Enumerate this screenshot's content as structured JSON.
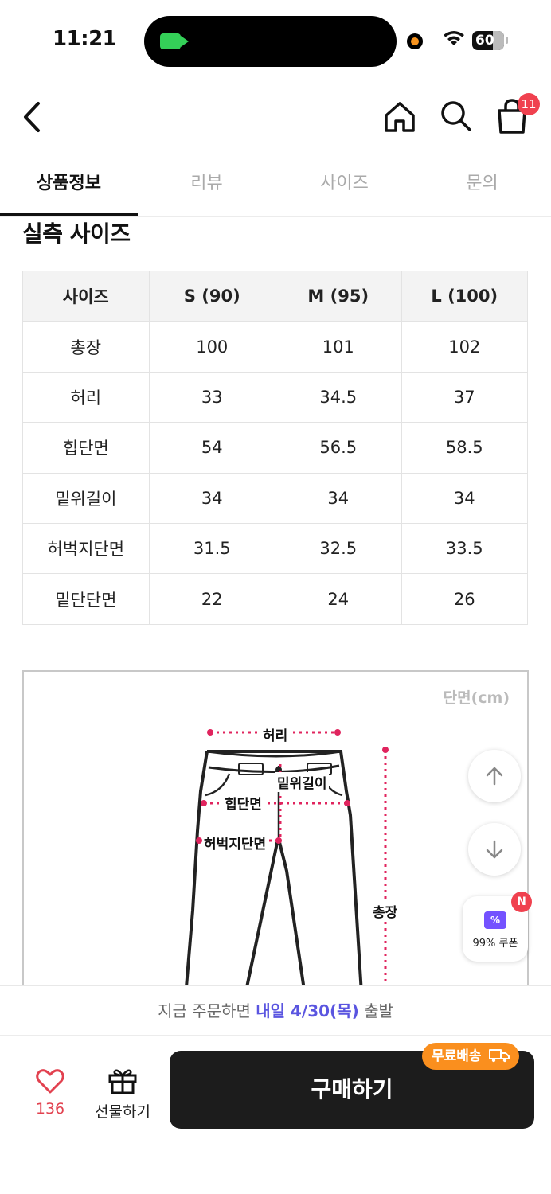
{
  "status": {
    "time": "11:21",
    "battery": "60"
  },
  "header": {
    "cart_count": "11"
  },
  "tabs": [
    {
      "label": "상품정보",
      "active": true
    },
    {
      "label": "리뷰"
    },
    {
      "label": "사이즈"
    },
    {
      "label": "문의"
    }
  ],
  "size_section": {
    "title": "실측 사이즈",
    "headers": [
      "사이즈",
      "S (90)",
      "M (95)",
      "L (100)"
    ],
    "rows": [
      [
        "총장",
        "100",
        "101",
        "102"
      ],
      [
        "허리",
        "33",
        "34.5",
        "37"
      ],
      [
        "힙단면",
        "54",
        "56.5",
        "58.5"
      ],
      [
        "밑위길이",
        "34",
        "34",
        "34"
      ],
      [
        "허벅지단면",
        "31.5",
        "32.5",
        "33.5"
      ],
      [
        "밑단단면",
        "22",
        "24",
        "26"
      ]
    ]
  },
  "diagram": {
    "unit": "단면(cm)",
    "labels": {
      "waist": "허리",
      "rise": "밑위길이",
      "hip": "힙단면",
      "thigh": "허벅지단면",
      "length": "총장"
    }
  },
  "coupon": {
    "label": "99% 쿠폰",
    "badge": "N"
  },
  "bottom": {
    "ship_prefix": "지금 주문하면 ",
    "ship_highlight": "내일 4/30(목)",
    "ship_suffix": " 출발",
    "like_count": "136",
    "gift_label": "선물하기",
    "buy_label": "구매하기",
    "free_ship_label": "무료배송"
  },
  "colors": {
    "accent": "#f0414f",
    "highlight": "#5a55e0",
    "free_ship": "#fa8f1e",
    "buy_button": "#1c1c1c"
  }
}
